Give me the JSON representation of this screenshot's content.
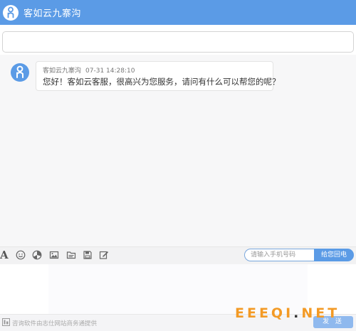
{
  "header": {
    "title": "客如云九寨沟"
  },
  "message": {
    "sender": "客如云九寨沟",
    "time": "07-31 14:28:10",
    "text": "您好！客如云客服，很高兴为您服务，请问有什么可以帮您的呢？"
  },
  "toolbar": {
    "font_icon": "A",
    "tools": [
      "font-icon",
      "emoji-icon",
      "screenshot-icon",
      "image-icon",
      "folder-icon",
      "save-icon",
      "edit-icon"
    ]
  },
  "callback": {
    "phone_placeholder": "请输入手机号码",
    "button_label": "给您回电"
  },
  "footer": {
    "powered_by": "咨询软件由志仕网站商务通提供",
    "send_label": "发 送"
  },
  "watermark": {
    "brand": "EEEQI",
    "dot": ".",
    "tld": "NET"
  },
  "colors": {
    "accent": "#5b9be6",
    "watermark": "#f39a25"
  }
}
